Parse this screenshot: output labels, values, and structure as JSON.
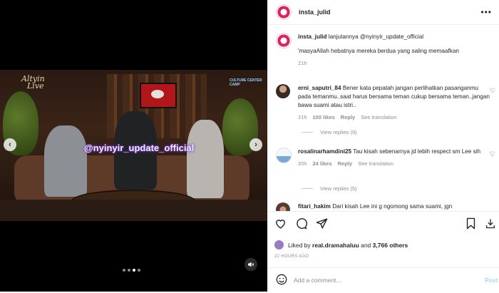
{
  "post": {
    "username": "insta_julid",
    "more_label": "•••"
  },
  "media": {
    "watermark": "@nyinyir_update_official",
    "logo_left_line1": "Altyin",
    "logo_left_line2": "Live",
    "logo_right": "CULTURE CENTER CAMP",
    "prev_label": "‹",
    "next_label": "›",
    "carousel_count": 4,
    "carousel_active": 3
  },
  "caption": {
    "username": "insta_julid",
    "text": "lanjutannya @nyinyir_update_official",
    "text2": "'masyaAllah hebatnya mereka berdua yang saling memaafkan",
    "time": "21h"
  },
  "comments": [
    {
      "username": "erni_saputri_84",
      "text": "Bener kata pepatah jangan perlihatkan pasanganmu pada temanmu..saat harus bersama teman cukup bersama teman..jangan bawa suami atau istri..",
      "time": "21h",
      "likes": "100 likes",
      "reply": "Reply",
      "translate": "See translation",
      "view_replies": "View replies (9)"
    },
    {
      "username": "rosalinarhamdini25",
      "text": "Tau kisah sebenarnya jd lebih respect sm Lee sih",
      "time": "20h",
      "likes": "24 likes",
      "reply": "Reply",
      "translate": "See translation",
      "view_replies": "View replies (5)"
    },
    {
      "username": "fitari_hakim",
      "text": "Dari kisah Lee ini g ngomong sama suami, jgn"
    }
  ],
  "actions": {
    "liked_prefix": "Liked by",
    "liked_user": "real.dramahaluu",
    "liked_and": "and",
    "liked_count": "3,766 others",
    "timestamp": "22 HOURS AGO",
    "add_comment_placeholder": "Add a comment...",
    "post_label": "Post"
  },
  "icons": {
    "like": "heart-icon",
    "comment": "comment-icon",
    "share": "share-icon",
    "save": "bookmark-icon",
    "download": "download-icon",
    "emoji": "emoji-icon",
    "mute": "speaker-muted-icon"
  },
  "colors": {
    "accent": "#0095f6",
    "post_disabled": "#a8d4f8",
    "muted_text": "#8e8e8e"
  }
}
